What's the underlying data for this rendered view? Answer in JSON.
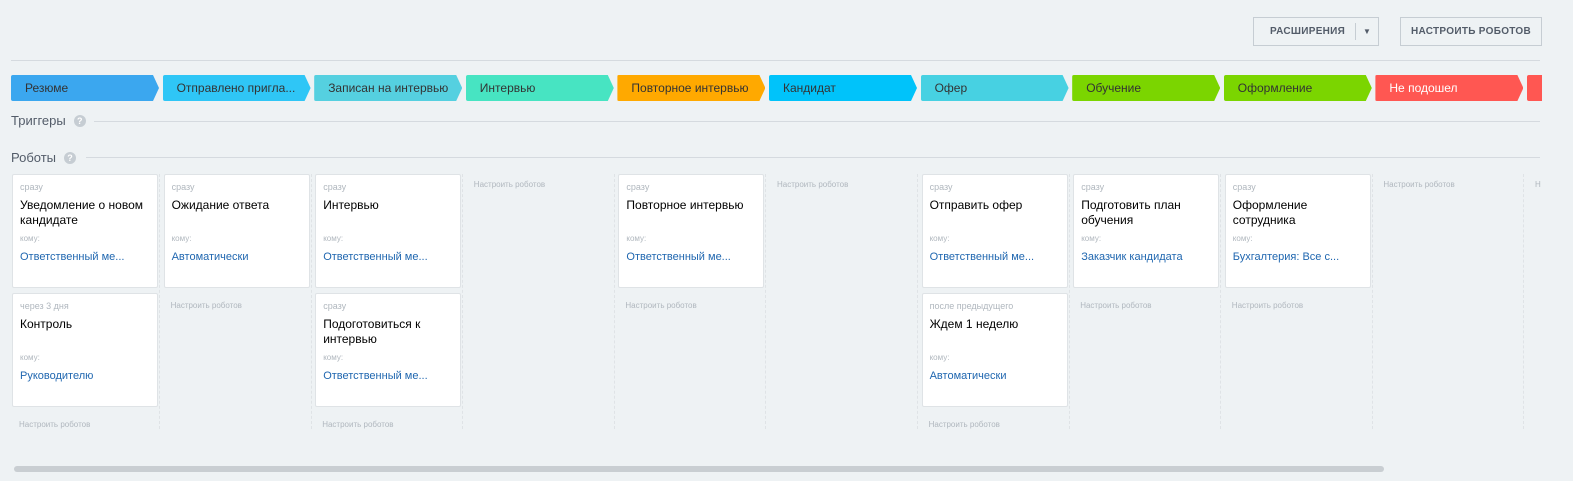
{
  "toolbar": {
    "extensions_label": "РАСШИРЕНИЯ",
    "configure_label": "НАСТРОИТЬ РОБОТОВ"
  },
  "stages": [
    {
      "label": "Резюме",
      "color": "#3ba7ef",
      "text": "#333"
    },
    {
      "label": "Отправлено пригла...",
      "color": "#2fc6f6",
      "text": "#333"
    },
    {
      "label": "Записан на интервью",
      "color": "#55d0e0",
      "text": "#333"
    },
    {
      "label": "Интервью",
      "color": "#47e4c2",
      "text": "#333"
    },
    {
      "label": "Повторное интервью",
      "color": "#ffa900",
      "text": "#333"
    },
    {
      "label": "Кандидат",
      "color": "#00c3fa",
      "text": "#333"
    },
    {
      "label": "Офер",
      "color": "#47d1e2",
      "text": "#333"
    },
    {
      "label": "Обучение",
      "color": "#7bd500",
      "text": "#333"
    },
    {
      "label": "Оформление",
      "color": "#7bd500",
      "text": "#333"
    },
    {
      "label": "Не подошел",
      "color": "#ff5752",
      "text": "#fff"
    },
    {
      "label": "",
      "color": "#ff5752",
      "text": "#fff"
    }
  ],
  "sections": {
    "triggers": "Триггеры",
    "robots": "Роботы",
    "help": "?"
  },
  "to_label": "кому:",
  "configure_robots": "Настроить роботов",
  "configure_robots_short": "Н",
  "columns": [
    {
      "robots": [
        {
          "when": "сразу",
          "title": "Уведомление о новом кандидате",
          "who": "Ответственный ме..."
        },
        {
          "when": "через 3 дня",
          "title": "Контроль",
          "who": "Руководителю"
        }
      ]
    },
    {
      "robots": [
        {
          "when": "сразу",
          "title": "Ожидание ответа",
          "who": "Автоматически"
        }
      ]
    },
    {
      "robots": [
        {
          "when": "сразу",
          "title": "Интервью",
          "who": "Ответственный ме..."
        },
        {
          "when": "сразу",
          "title": "Подоготовиться к интервью",
          "who": "Ответственный ме..."
        }
      ]
    },
    {
      "robots": []
    },
    {
      "robots": [
        {
          "when": "сразу",
          "title": "Повторное интервью",
          "who": "Ответственный ме..."
        }
      ]
    },
    {
      "robots": []
    },
    {
      "robots": [
        {
          "when": "сразу",
          "title": "Отправить офер",
          "who": "Ответственный ме..."
        },
        {
          "when": "после предыдущего",
          "title": "Ждем 1 неделю",
          "who": "Автоматически"
        }
      ]
    },
    {
      "robots": [
        {
          "when": "сразу",
          "title": "Подготовить план обучения",
          "who": "Заказчик кандидата"
        }
      ]
    },
    {
      "robots": [
        {
          "when": "сразу",
          "title": "Оформление сотрудника",
          "who": "Бухгалтерия: Все с..."
        }
      ]
    },
    {
      "robots": []
    },
    {
      "robots": []
    }
  ]
}
